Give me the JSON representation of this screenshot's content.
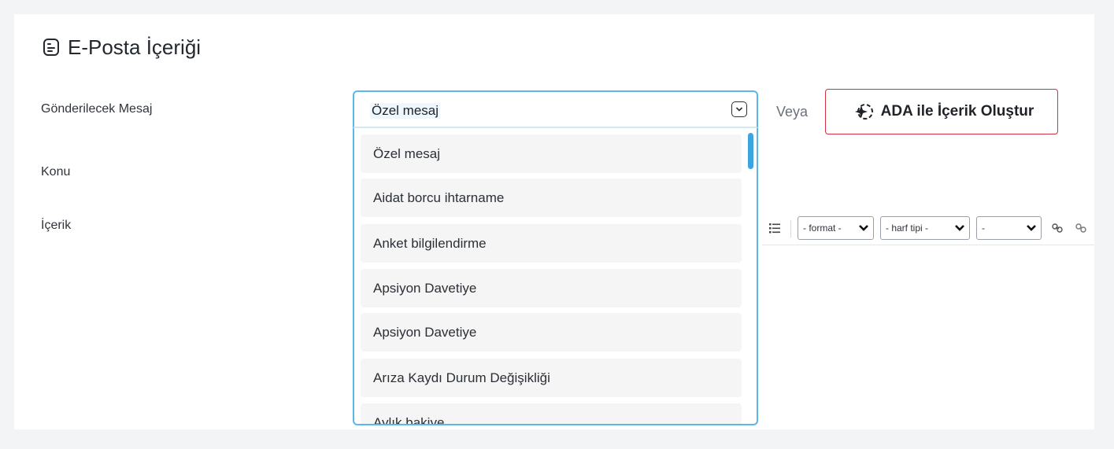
{
  "page": {
    "title": "E-Posta İçeriği",
    "title_icon": "document-icon"
  },
  "form": {
    "message_label": "Gönderilecek Mesaj",
    "subject_label": "Konu",
    "content_label": "İçerik",
    "select": {
      "value": "Özel mesaj",
      "options": [
        "Özel mesaj",
        "Aidat borcu ihtarname",
        "Anket bilgilendirme",
        "Apsiyon Davetiye",
        "Apsiyon Davetiye",
        "Arıza Kaydı Durum Değişikliği",
        "Aylık bakiye"
      ]
    },
    "or_text": "Veya",
    "ada_button_label": "ADA ile İçerik Oluştur",
    "ada_icon": "sparkle-icon"
  },
  "editor_toolbar": {
    "format_select": "- format -",
    "font_select": "- harf tipi -",
    "size_select": "-",
    "icons": [
      "bullet-list-icon",
      "link-icon",
      "unlink-icon"
    ]
  },
  "colors": {
    "focus_border": "#59b7ea",
    "scroll_thumb": "#3aa5e0",
    "ada_border": "#d0323f",
    "option_bg": "#f5f5f6"
  }
}
